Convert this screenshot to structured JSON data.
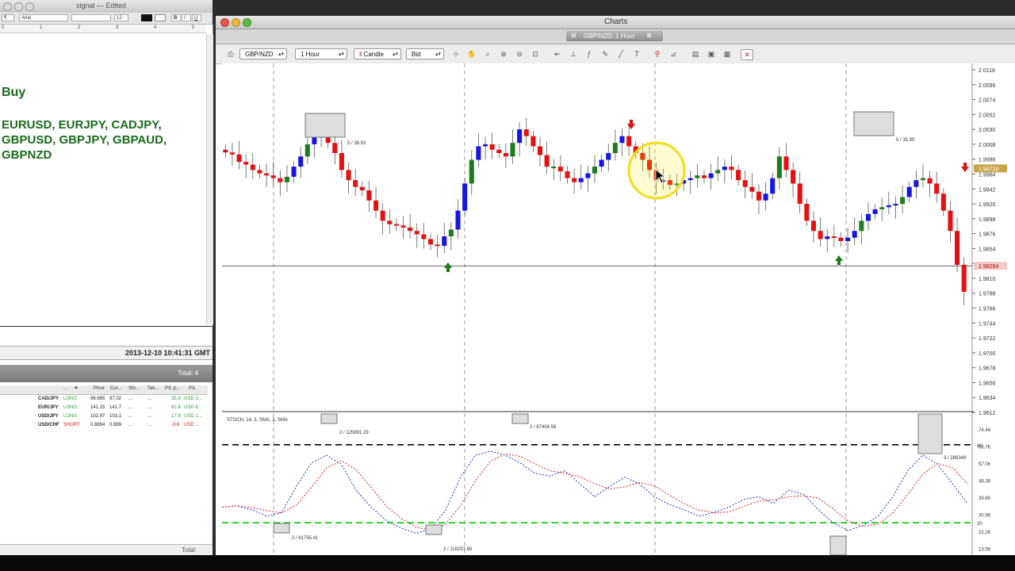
{
  "editor": {
    "title": "signal — Edited",
    "font_name": "Arial",
    "font_size": "12",
    "ruler_marks": [
      "0",
      "1",
      "2",
      "3",
      "4",
      "5"
    ],
    "heading": "Buy",
    "pairs_text": "EURUSD, EURJPY, CADJPY, GBPUSD, GBPJPY, GBPAUD, GBPNZD"
  },
  "positions": {
    "timestamp": "2013-12-10 10:41:31 GMT",
    "total_top": "Total: 4",
    "total_bottom": "Total:",
    "headers": [
      "...",
      "Price",
      "Cur...",
      "Sto...",
      "Tak...",
      "P/L p...",
      "P/L"
    ],
    "rows": [
      {
        "pair": "CAD/JPY",
        "side": "LONG",
        "price": "96.665",
        "current": "97.02",
        "stop": "...",
        "take": "...",
        "plp": "35.8",
        "pl": "USD 3..."
      },
      {
        "pair": "EUR/JPY",
        "side": "LONG",
        "price": "141.15",
        "current": "141.7",
        "stop": "...",
        "take": "...",
        "plp": "62.8",
        "pl": "USD 6..."
      },
      {
        "pair": "USD/JPY",
        "side": "LONG",
        "price": "102.97",
        "current": "103.1",
        "stop": "...",
        "take": "...",
        "plp": "17.9",
        "pl": "USD 1..."
      },
      {
        "pair": "USD/CHF",
        "side": "SHORT",
        "price": "0.8894",
        "current": "0.889",
        "stop": "...",
        "take": "...",
        "plp": "-3.6",
        "pl": "USD ..."
      }
    ]
  },
  "charts": {
    "window_title": "Charts",
    "tab_label": "GBP/NZD, 1 Hour",
    "instrument": "GBP/NZD",
    "period": "1 Hour",
    "chart_style": "Candle",
    "price_side": "Bid",
    "colors": {
      "up": "#1515e6",
      "down": "#e61010",
      "up_alt": "#1d7a1d",
      "level_green": "#00cc00",
      "stoch_k": "#2233cc",
      "stoch_d": "#dd2222"
    },
    "price_box_labels": [
      "5 / 38.93",
      "5 / 35.95"
    ],
    "stoch_box_labels": [
      "2 / 125691.29",
      "2 / 67404.58",
      "2 / 61755.41",
      "2 / 118297.69",
      "3 / 286348"
    ],
    "stoch_header": "STOCH, 14, 3, SMA, 3, SMA",
    "stoch_top_value": "80",
    "stoch_bottom_value": "20"
  },
  "chart_data": {
    "type": "candlestick",
    "instrument": "GBP/NZD",
    "timeframe": "1 Hour",
    "y_ticks": [
      "2.0118",
      "2.0096",
      "2.0074",
      "2.0052",
      "2.0030",
      "2.0008",
      "1.9986",
      "1.9964",
      "1.9942",
      "1.9920",
      "1.9898",
      "1.9876",
      "1.9854",
      "1.9832",
      "1.9810",
      "1.9788",
      "1.9766",
      "1.9744",
      "1.9722",
      "1.9700",
      "1.9678",
      "1.9656",
      "1.9634",
      "1.9612"
    ],
    "ylim": [
      1.9612,
      2.0118
    ],
    "current_price": "1.99724",
    "horizontal_line_price": "1.98284",
    "close_series": [
      1.9996,
      1.9993,
      1.9982,
      1.9978,
      1.997,
      1.9965,
      1.9962,
      1.9958,
      1.9952,
      1.996,
      1.9975,
      1.999,
      2.0008,
      2.0018,
      2.002,
      2.001,
      1.9995,
      1.997,
      1.9955,
      1.9945,
      1.994,
      1.9925,
      1.991,
      1.9895,
      1.989,
      1.9888,
      1.9885,
      1.988,
      1.9875,
      1.9868,
      1.986,
      1.9858,
      1.9872,
      1.9882,
      1.991,
      1.995,
      1.9985,
      2.0005,
      2.0008,
      2.0,
      1.9995,
      1.999,
      2.001,
      2.003,
      2.002,
      2.0005,
      1.9992,
      1.9975,
      1.9975,
      1.9968,
      1.9958,
      1.9952,
      1.9958,
      1.9965,
      1.9975,
      1.9985,
      1.9995,
      2.001,
      2.002,
      2.0005,
      1.9995,
      1.9985,
      1.997,
      1.9955,
      1.9955,
      1.9948,
      1.995,
      1.9955,
      1.9958,
      1.9962,
      1.9958,
      1.9965,
      1.997,
      1.9975,
      1.997,
      1.9955,
      1.9945,
      1.9938,
      1.9925,
      1.9935,
      1.9958,
      1.999,
      1.997,
      1.995,
      1.992,
      1.9895,
      1.988,
      1.9868,
      1.9872,
      1.987,
      1.9865,
      1.987,
      1.988,
      1.9895,
      1.9905,
      1.9912,
      1.9915,
      1.9918,
      1.992,
      1.993,
      1.9945,
      1.9955,
      1.9958,
      1.995,
      1.9935,
      1.991,
      1.988,
      1.983,
      1.979
    ],
    "stoch_k": [
      32,
      33,
      30,
      25,
      28,
      48,
      66,
      72,
      65,
      45,
      32,
      22,
      16,
      12,
      15,
      30,
      55,
      72,
      75,
      72,
      66,
      58,
      56,
      60,
      50,
      40,
      48,
      55,
      50,
      40,
      34,
      30,
      25,
      28,
      32,
      38,
      40,
      35,
      45,
      42,
      30,
      20,
      14,
      18,
      25,
      40,
      60,
      72,
      65,
      50,
      35
    ]
  }
}
